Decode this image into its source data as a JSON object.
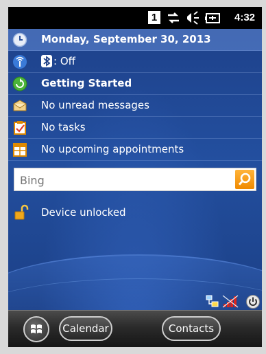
{
  "status_bar": {
    "notification_count": "1",
    "time": "4:32",
    "icons": [
      "data-arrows-icon",
      "speaker-icon",
      "battery-charging-icon"
    ]
  },
  "today": {
    "date": "Monday, September 30, 2013",
    "bluetooth_status": ": Off",
    "getting_started": "Getting Started",
    "messages": "No unread messages",
    "tasks": "No tasks",
    "appointments": "No upcoming appointments"
  },
  "search": {
    "placeholder": "Bing"
  },
  "device_status": "Device unlocked",
  "tray_icons": [
    "network-icon",
    "signal-strength-icon",
    "power-icon"
  ],
  "softkeys": {
    "left": "Calendar",
    "right": "Contacts"
  },
  "colors": {
    "accent_orange": "#f08a00",
    "background_blue": "#1e3f86",
    "selected_row": "#4f74c4"
  }
}
